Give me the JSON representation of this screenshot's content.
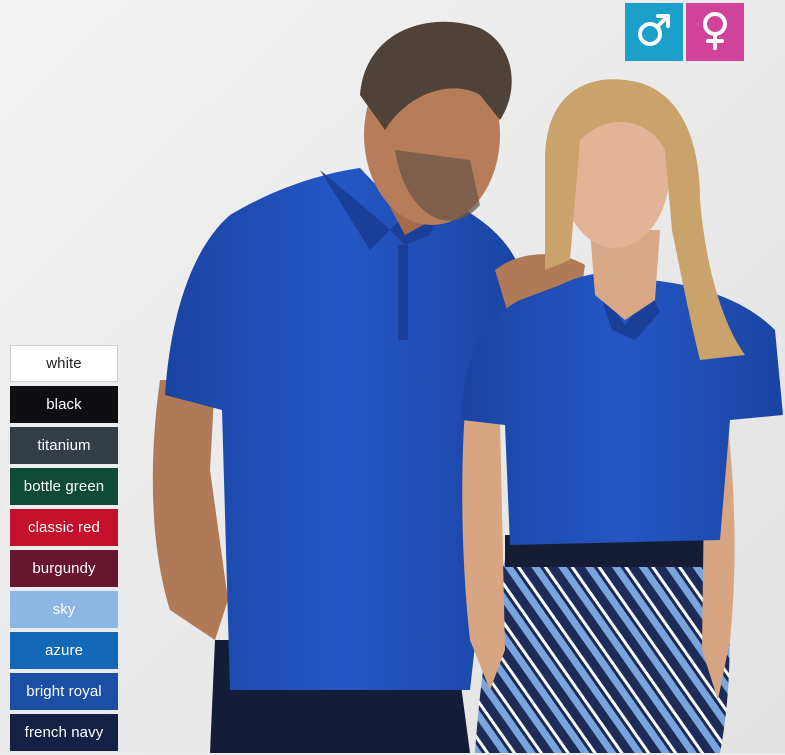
{
  "gender_filter": {
    "male_icon": "male-symbol-icon",
    "female_icon": "female-symbol-icon",
    "male_color": "#1aa0c9",
    "female_color": "#d1439b"
  },
  "colour_swatches": [
    {
      "label": "white",
      "color": "#ffffff"
    },
    {
      "label": "black",
      "color": "#0e0e12"
    },
    {
      "label": "titanium",
      "color": "#353d47"
    },
    {
      "label": "bottle green",
      "color": "#0e4b36"
    },
    {
      "label": "classic red",
      "color": "#c4102d"
    },
    {
      "label": "burgundy",
      "color": "#6a1530"
    },
    {
      "label": "sky",
      "color": "#8cb6e3"
    },
    {
      "label": "azure",
      "color": "#1369b8"
    },
    {
      "label": "bright royal",
      "color": "#1a4fa3"
    },
    {
      "label": "french navy",
      "color": "#152046"
    }
  ],
  "product_photo": {
    "shirt_color": "#1f4fb6",
    "skirt_colors": [
      "#1c2b57",
      "#7aa5dc",
      "#ffffff"
    ]
  }
}
